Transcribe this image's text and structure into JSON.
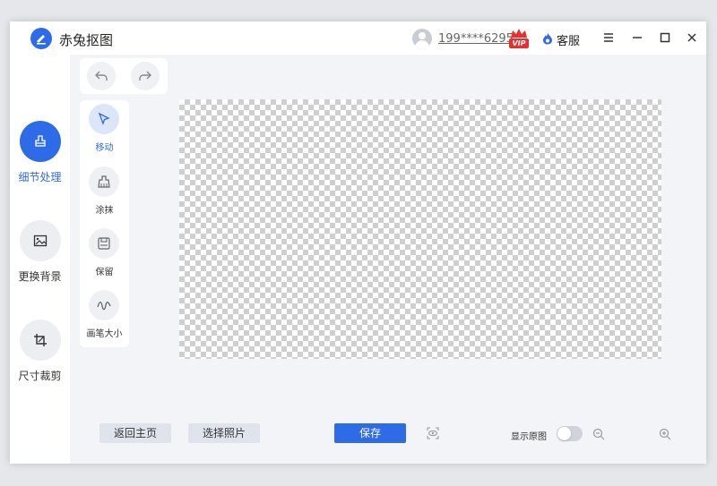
{
  "app": {
    "title": "赤兔抠图"
  },
  "user": {
    "phone": "199****6295",
    "vip_badge": "VIP"
  },
  "header": {
    "service_label": "客服"
  },
  "nav": {
    "items": [
      {
        "label": "细节处理",
        "icon": "brush-icon",
        "active": true
      },
      {
        "label": "更换背景",
        "icon": "image-icon",
        "active": false
      },
      {
        "label": "尺寸裁剪",
        "icon": "crop-icon",
        "active": false
      }
    ]
  },
  "tools": {
    "items": [
      {
        "label": "移动",
        "icon": "cursor-icon",
        "active": true
      },
      {
        "label": "涂抹",
        "icon": "smear-brush-icon",
        "active": false
      },
      {
        "label": "保留",
        "icon": "save-box-icon",
        "active": false
      },
      {
        "label": "画笔大小",
        "icon": "wave-icon",
        "active": false
      }
    ]
  },
  "footer": {
    "back_label": "返回主页",
    "select_label": "选择照片",
    "save_label": "保存",
    "show_original_label": "显示原图",
    "show_original_on": false
  },
  "colors": {
    "accent": "#2e6be6",
    "vip_red": "#e53030"
  }
}
